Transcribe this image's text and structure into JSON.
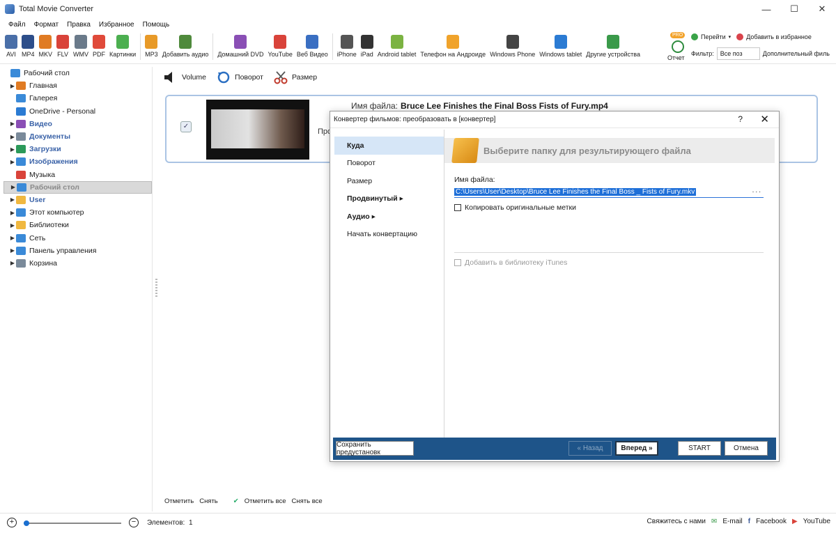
{
  "window": {
    "title": "Total Movie Converter",
    "min": "—",
    "max": "☐",
    "close": "✕"
  },
  "menu": [
    "Файл",
    "Формат",
    "Правка",
    "Избранное",
    "Помощь"
  ],
  "toolbar": {
    "formats": [
      {
        "label": "AVI",
        "color": "#4a6fa8"
      },
      {
        "label": "MP4",
        "color": "#2d4e8a"
      },
      {
        "label": "MKV",
        "color": "#e07b23"
      },
      {
        "label": "FLV",
        "color": "#d9433a"
      },
      {
        "label": "WMV",
        "color": "#6a7a8a"
      },
      {
        "label": "PDF",
        "color": "#e04a3a"
      },
      {
        "label": "Картинки",
        "color": "#4caf50"
      }
    ],
    "audio": [
      {
        "label": "MP3",
        "color": "#e89a28"
      },
      {
        "label": "Добавить аудио",
        "color": "#4f8a3c"
      }
    ],
    "web": [
      {
        "label": "Домашний DVD",
        "color": "#8a4fb5"
      },
      {
        "label": "YouTube",
        "color": "#d9433a"
      },
      {
        "label": "Веб Видео",
        "color": "#3a6fc2"
      }
    ],
    "devices": [
      {
        "label": "iPhone",
        "color": "#555"
      },
      {
        "label": "iPad",
        "color": "#333"
      },
      {
        "label": "Android tablet",
        "color": "#7bb342"
      },
      {
        "label": "Телефон на Андроиде",
        "color": "#f0a32b"
      },
      {
        "label": "Windows Phone",
        "color": "#444"
      },
      {
        "label": "Windows tablet",
        "color": "#2b7bd3"
      },
      {
        "label": "Другие устройства",
        "color": "#3a9a4a"
      }
    ],
    "report": {
      "badge": "PRO",
      "label": "Отчет"
    },
    "goto": "Перейти",
    "favorites": "Добавить в избранное",
    "filter_label": "Фильтр:",
    "filter_value": "Все поз",
    "extra_filter": "Дополнительный филь"
  },
  "tree": [
    {
      "label": "Рабочий стол",
      "arrow": "",
      "color": "#3a8ad8",
      "style": "",
      "indent": 0
    },
    {
      "label": "Главная",
      "arrow": "▶",
      "color": "#e07b23",
      "style": "",
      "indent": 1
    },
    {
      "label": "Галерея",
      "arrow": "",
      "color": "#3a8ad8",
      "style": "",
      "indent": 1
    },
    {
      "label": "OneDrive - Personal",
      "arrow": "",
      "color": "#2b7bd3",
      "style": "",
      "indent": 1
    },
    {
      "label": "Видео",
      "arrow": "▶",
      "color": "#8a4fb5",
      "style": "bold",
      "indent": 1
    },
    {
      "label": "Документы",
      "arrow": "▶",
      "color": "#7a8a9a",
      "style": "bold",
      "indent": 1
    },
    {
      "label": "Загрузки",
      "arrow": "▶",
      "color": "#2b9a5a",
      "style": "bold",
      "indent": 1
    },
    {
      "label": "Изображения",
      "arrow": "▶",
      "color": "#3a8ad8",
      "style": "bold",
      "indent": 1
    },
    {
      "label": "Музыка",
      "arrow": "",
      "color": "#d9433a",
      "style": "",
      "indent": 1
    },
    {
      "label": "Рабочий стол",
      "arrow": "▶",
      "color": "#3a8ad8",
      "style": "sel",
      "indent": 1
    },
    {
      "label": "User",
      "arrow": "▶",
      "color": "#f0b840",
      "style": "bold",
      "indent": 1
    },
    {
      "label": "Этот компьютер",
      "arrow": "▶",
      "color": "#3a8ad8",
      "style": "",
      "indent": 1
    },
    {
      "label": "Библиотеки",
      "arrow": "▶",
      "color": "#f0b840",
      "style": "",
      "indent": 1
    },
    {
      "label": "Сеть",
      "arrow": "▶",
      "color": "#3a8ad8",
      "style": "",
      "indent": 1
    },
    {
      "label": "Панель управления",
      "arrow": "▶",
      "color": "#3a8ad8",
      "style": "",
      "indent": 1
    },
    {
      "label": "Корзина",
      "arrow": "▶",
      "color": "#7a8a9a",
      "style": "",
      "indent": 1
    }
  ],
  "actions": {
    "volume": "Volume",
    "rotate": "Поворот",
    "size": "Размер"
  },
  "file": {
    "name_label": "Имя файла:",
    "name": "Bruce Lee Finishes the Final Boss   Fists of Fury.mp4",
    "prop_label": "Проп"
  },
  "bottom_links": {
    "mark": "Отметить",
    "unmark": "Снять",
    "mark_all": "Отметить все",
    "unmark_all": "Снять все"
  },
  "status": {
    "plus": "+",
    "minus": "−",
    "elements_label": "Элементов:",
    "elements_count": "1",
    "contact": "Свяжитесь с нами",
    "email": "E-mail",
    "facebook": "Facebook",
    "youtube": "YouTube",
    "zoom_fraction": 0
  },
  "dialog": {
    "title": "Конвертер фильмов: преобразовать в [конвертер]",
    "help": "?",
    "close": "✕",
    "nav": [
      {
        "label": "Куда",
        "style": "active"
      },
      {
        "label": "Поворот",
        "style": ""
      },
      {
        "label": "Размер",
        "style": ""
      },
      {
        "label": "Продвинутый ▸",
        "style": "bold"
      },
      {
        "label": "Аудио ▸",
        "style": "bold"
      },
      {
        "label": "Начать конвертацию",
        "style": ""
      }
    ],
    "header": "Выберите папку для результирующего файла",
    "filename_label": "Имя файла:",
    "path": "C:\\Users\\User\\Desktop\\Bruce Lee Finishes the Final Boss _ Fists of Fury.mkv",
    "browse": "...",
    "copy_tags": "Копировать оригинальные метки",
    "itunes": "Добавить в библиотеку iTunes",
    "buttons": {
      "save_preset": "Сохранить предустановк",
      "back": "« Назад",
      "next": "Вперед »",
      "start": "START",
      "cancel": "Отмена"
    }
  }
}
